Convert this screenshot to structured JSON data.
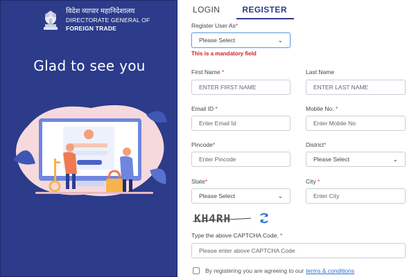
{
  "brand": {
    "hindi": "विदेश व्यापार महानिदेशालय",
    "english_line1": "DIRECTORATE GENERAL OF",
    "english_line2": "FOREIGN TRADE"
  },
  "welcome_text": "Glad to see you",
  "tabs": {
    "login": "LOGIN",
    "register": "REGISTER"
  },
  "form": {
    "register_as": {
      "label": "Register User As",
      "required_mark": "*",
      "value": "Please Select",
      "error": "This is a mandatory field"
    },
    "first_name": {
      "label": "First Name",
      "required_mark": " *",
      "placeholder": "ENTER FIRST NAME"
    },
    "last_name": {
      "label": "Last Name",
      "placeholder": "ENTER LAST NAME"
    },
    "email": {
      "label": "Email ID",
      "required_mark": " *",
      "placeholder": "Enter Email Id"
    },
    "mobile": {
      "label": "Moblie No.",
      "required_mark": " *",
      "placeholder": "Enter Mobile No"
    },
    "pincode": {
      "label": "Pincode",
      "required_mark": "*",
      "placeholder": "Enter Pincode"
    },
    "district": {
      "label": "District",
      "required_mark": "*",
      "value": "Please Select"
    },
    "state": {
      "label": "State",
      "required_mark": "*",
      "value": "Please Select"
    },
    "city": {
      "label": "City",
      "required_mark": " *",
      "placeholder": "Enter City"
    },
    "captcha": {
      "text": "KH4RH",
      "label": "Type the above CAPTCHA Code.",
      "required_mark": " *",
      "placeholder": "Please enter above CAPTCHA Code"
    },
    "consent": {
      "text": "By registering you are agreeing to our",
      "link": "terms & conditions"
    }
  },
  "colors": {
    "panel": "#2c3b8a",
    "required": "#e0332f",
    "link": "#2a6fd6"
  },
  "icons": [
    "national-emblem-icon",
    "chevron-down-icon",
    "refresh-icon"
  ]
}
